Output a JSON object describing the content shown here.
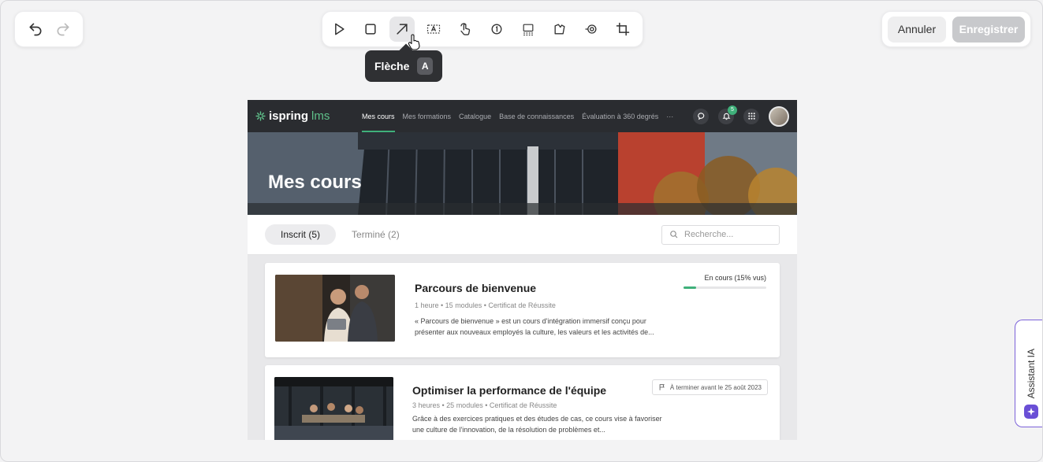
{
  "history": {
    "undo_icon": "undo-icon",
    "redo_icon": "redo-icon"
  },
  "toolbar": {
    "tools": [
      "pointer-icon",
      "rectangle-icon",
      "arrow-icon",
      "text-box-icon",
      "click-hand-icon",
      "step-number-icon",
      "blur-icon",
      "highlight-icon",
      "spotlight-icon",
      "crop-icon"
    ],
    "active_tool": "arrow-icon"
  },
  "tooltip": {
    "label": "Flèche",
    "shortcut": "A"
  },
  "actions": {
    "cancel_label": "Annuler",
    "save_label": "Enregistrer"
  },
  "ai_assistant": {
    "label": "Assistant IA"
  },
  "screenshot": {
    "logo": {
      "name": "ispring",
      "suffix": "lms"
    },
    "nav": [
      "Mes cours",
      "Mes formations",
      "Catalogue",
      "Base de connaissances",
      "Évaluation à 360 degrés",
      "···"
    ],
    "notifications_count": "5",
    "hero_title": "Mes cours",
    "tabs": [
      {
        "label": "Inscrit (5)"
      },
      {
        "label": "Terminé (2)"
      }
    ],
    "search_placeholder": "Recherche...",
    "courses": [
      {
        "title": "Parcours de bienvenue",
        "meta": "1 heure  •  15 modules  •  Certificat de Réussite",
        "description": "« Parcours de bienvenue » est un cours d'intégration immersif conçu pour présenter aux nouveaux employés la culture, les valeurs et les activités de...",
        "status": "En cours (15% vus)",
        "progress_fraction": 0.15
      },
      {
        "title": "Optimiser la performance de l'équipe",
        "meta": "3 heures  •  25 modules  •  Certificat de Réussite",
        "description": "Grâce à des exercices pratiques et des études de cas, ce cours vise à favoriser une culture de l'innovation, de la résolution de problèmes et...",
        "deadline": "À terminer avant le 25 août 2023"
      }
    ]
  },
  "colors": {
    "accent_green": "#3fb07a",
    "ai_purple": "#6a4fd6",
    "tooltip_bg": "#2f3033"
  }
}
